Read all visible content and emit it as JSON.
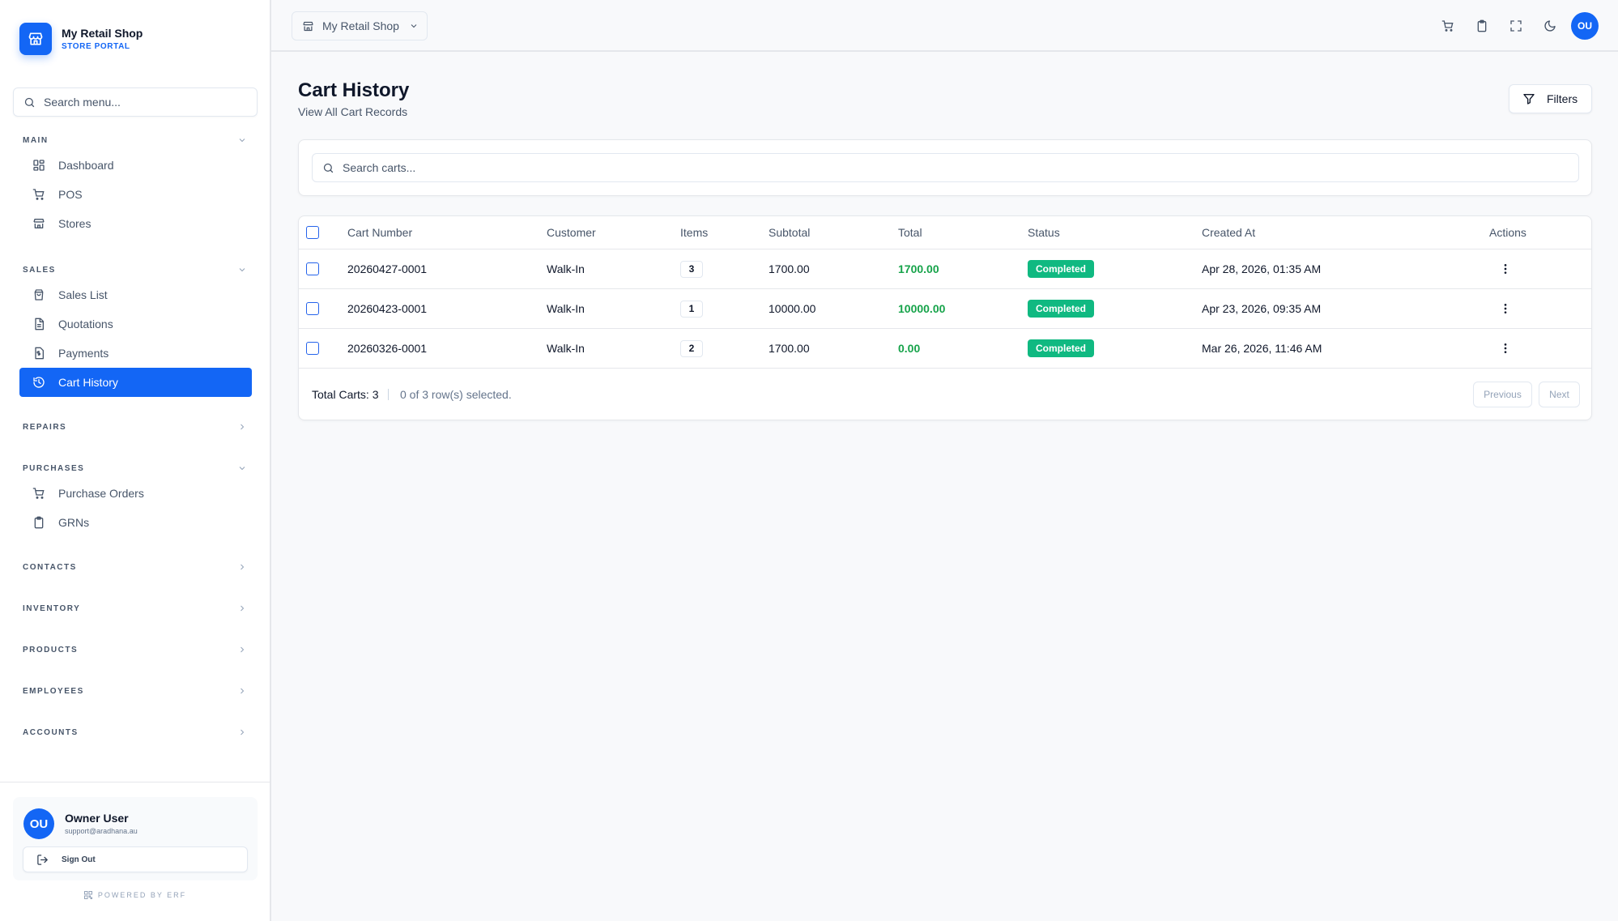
{
  "brand": {
    "name": "My Retail Shop",
    "subtitle": "STORE PORTAL"
  },
  "sidebar_search": {
    "placeholder": "Search menu..."
  },
  "sections": [
    {
      "label": "MAIN",
      "expanded": true,
      "items": [
        {
          "label": "Dashboard",
          "icon": "dashboard-icon",
          "active": false
        },
        {
          "label": "POS",
          "icon": "cart-icon",
          "active": false
        },
        {
          "label": "Stores",
          "icon": "store-icon",
          "active": false
        }
      ]
    },
    {
      "label": "SALES",
      "expanded": true,
      "items": [
        {
          "label": "Sales List",
          "icon": "bag-icon",
          "active": false
        },
        {
          "label": "Quotations",
          "icon": "document-icon",
          "active": false
        },
        {
          "label": "Payments",
          "icon": "dollar-icon",
          "active": false
        },
        {
          "label": "Cart History",
          "icon": "history-icon",
          "active": true
        }
      ]
    },
    {
      "label": "REPAIRS",
      "expanded": false,
      "items": []
    },
    {
      "label": "PURCHASES",
      "expanded": true,
      "items": [
        {
          "label": "Purchase Orders",
          "icon": "cart-icon",
          "active": false
        },
        {
          "label": "GRNs",
          "icon": "clipboard-icon",
          "active": false
        }
      ]
    },
    {
      "label": "CONTACTS",
      "expanded": false,
      "items": []
    },
    {
      "label": "INVENTORY",
      "expanded": false,
      "items": []
    },
    {
      "label": "PRODUCTS",
      "expanded": false,
      "items": []
    },
    {
      "label": "EMPLOYEES",
      "expanded": false,
      "items": []
    },
    {
      "label": "ACCOUNTS",
      "expanded": false,
      "items": []
    }
  ],
  "user": {
    "initials": "OU",
    "name": "Owner User",
    "email": "support@aradhana.au",
    "signout_label": "Sign Out"
  },
  "powered_by": "POWERED BY ERF",
  "header": {
    "store_name": "My Retail Shop",
    "avatar_initials": "OU"
  },
  "page": {
    "title": "Cart History",
    "subtitle": "View All Cart Records",
    "filters_label": "Filters"
  },
  "cart_search": {
    "placeholder": "Search carts..."
  },
  "table": {
    "columns": [
      "Cart Number",
      "Customer",
      "Items",
      "Subtotal",
      "Total",
      "Status",
      "Created At",
      "Actions"
    ],
    "rows": [
      {
        "cart_number": "20260427-0001",
        "customer": "Walk-In",
        "items": "3",
        "subtotal": "1700.00",
        "total": "1700.00",
        "status": "Completed",
        "created_at": "Apr 28, 2026, 01:35 AM"
      },
      {
        "cart_number": "20260423-0001",
        "customer": "Walk-In",
        "items": "1",
        "subtotal": "10000.00",
        "total": "10000.00",
        "status": "Completed",
        "created_at": "Apr 23, 2026, 09:35 AM"
      },
      {
        "cart_number": "20260326-0001",
        "customer": "Walk-In",
        "items": "2",
        "subtotal": "1700.00",
        "total": "0.00",
        "status": "Completed",
        "created_at": "Mar 26, 2026, 11:46 AM"
      }
    ],
    "footer": {
      "total_label": "Total Carts: 3",
      "selected_label": "0 of 3 row(s) selected.",
      "prev_label": "Previous",
      "next_label": "Next"
    }
  },
  "colors": {
    "accent": "#1366f5",
    "success": "#10b981",
    "total_text": "#16a34a"
  }
}
